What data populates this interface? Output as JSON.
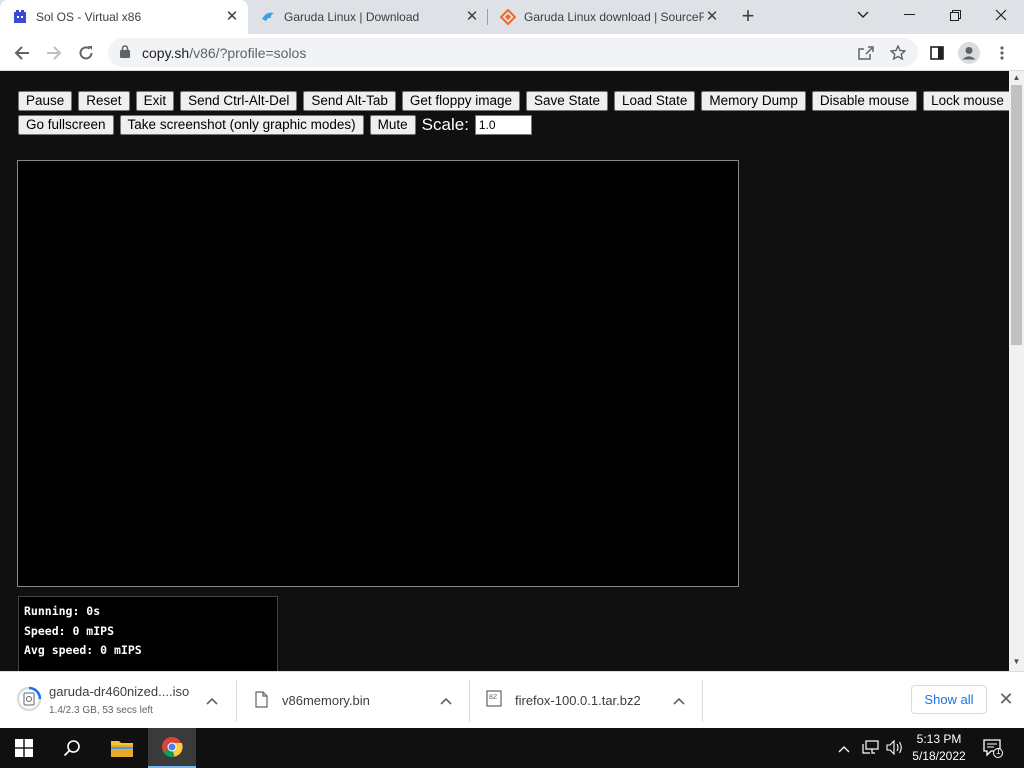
{
  "browser": {
    "tabs": [
      {
        "title": "Sol OS - Virtual x86",
        "active": true
      },
      {
        "title": "Garuda Linux | Download",
        "active": false
      },
      {
        "title": "Garuda Linux download | SourceForge",
        "active": false
      }
    ],
    "url_host": "copy.sh",
    "url_path": "/v86/?profile=solos"
  },
  "emulator": {
    "buttons_row1": [
      "Pause",
      "Reset",
      "Exit",
      "Send Ctrl-Alt-Del",
      "Send Alt-Tab",
      "Get floppy image",
      "Save State",
      "Load State",
      "Memory Dump",
      "Disable mouse",
      "Lock mouse"
    ],
    "buttons_row2": [
      "Go fullscreen",
      "Take screenshot (only graphic modes)",
      "Mute"
    ],
    "scale_label": "Scale:",
    "scale_value": "1.0",
    "stats": {
      "running": "Running: 0s",
      "speed": "Speed: 0 mIPS",
      "avg_speed": "Avg speed: 0 mIPS"
    }
  },
  "downloads": {
    "items": [
      {
        "name": "garuda-dr460nized....iso",
        "status": "1.4/2.3 GB, 53 secs left",
        "icon": "disc-icon"
      },
      {
        "name": "v86memory.bin",
        "status": "",
        "icon": "file-icon"
      },
      {
        "name": "firefox-100.0.1.tar.bz2",
        "status": "",
        "icon": "archive-icon"
      }
    ],
    "show_all": "Show all"
  },
  "taskbar": {
    "time": "5:13 PM",
    "date": "5/18/2022",
    "notification_count": "1"
  }
}
